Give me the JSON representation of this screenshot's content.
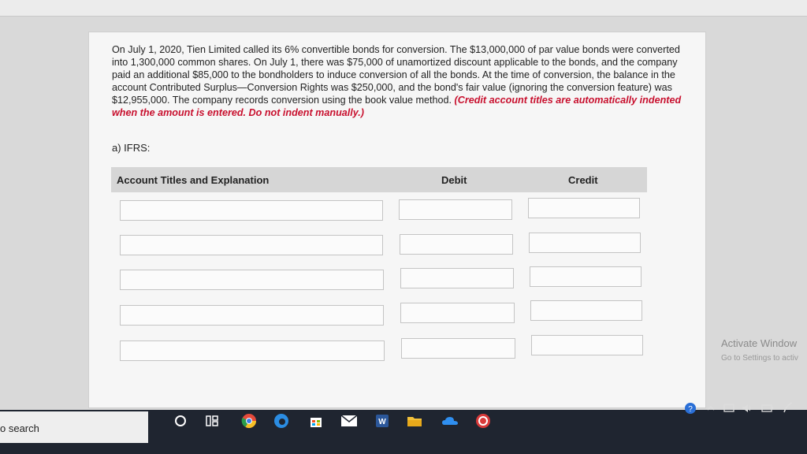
{
  "question": {
    "text": "On July 1, 2020, Tien Limited called its 6% convertible bonds for conversion. The $13,000,000 of par value bonds were converted into 1,300,000 common shares. On July 1, there was $75,000 of unamortized discount applicable to the bonds, and the company paid an additional $85,000 to the bondholders to induce conversion of all the bonds. At the time of conversion, the balance in the account Contributed Surplus—Conversion Rights was $250,000, and the bond's fair value (ignoring the conversion feature) was $12,955,000. The company records conversion using the book value method.",
    "instruction": "(Credit account titles are automatically indented when the amount is entered. Do not indent manually.)"
  },
  "section_label": "a) IFRS:",
  "table": {
    "headers": {
      "account": "Account Titles and Explanation",
      "debit": "Debit",
      "credit": "Credit"
    },
    "rows": [
      {
        "account": "",
        "debit": "",
        "credit": ""
      },
      {
        "account": "",
        "debit": "",
        "credit": ""
      },
      {
        "account": "",
        "debit": "",
        "credit": ""
      },
      {
        "account": "",
        "debit": "",
        "credit": ""
      },
      {
        "account": "",
        "debit": "",
        "credit": ""
      }
    ]
  },
  "watermark": {
    "line1": "Activate Window",
    "line2": "Go to Settings to activ"
  },
  "taskbar": {
    "search_text": "o search",
    "icons": [
      "cortana-icon",
      "task-view-icon",
      "chrome-icon",
      "edge-icon",
      "store-icon",
      "mail-icon",
      "word-icon",
      "file-explorer-icon",
      "onedrive-icon",
      "app-icon"
    ],
    "tray_icons": [
      "help-icon",
      "chevron-up-icon",
      "network-icon",
      "volume-icon",
      "battery-icon",
      "pen-icon"
    ]
  },
  "colors": {
    "instruction_red": "#c8102e",
    "header_bg": "#d6d6d6",
    "taskbar_bg": "#1f2530"
  }
}
